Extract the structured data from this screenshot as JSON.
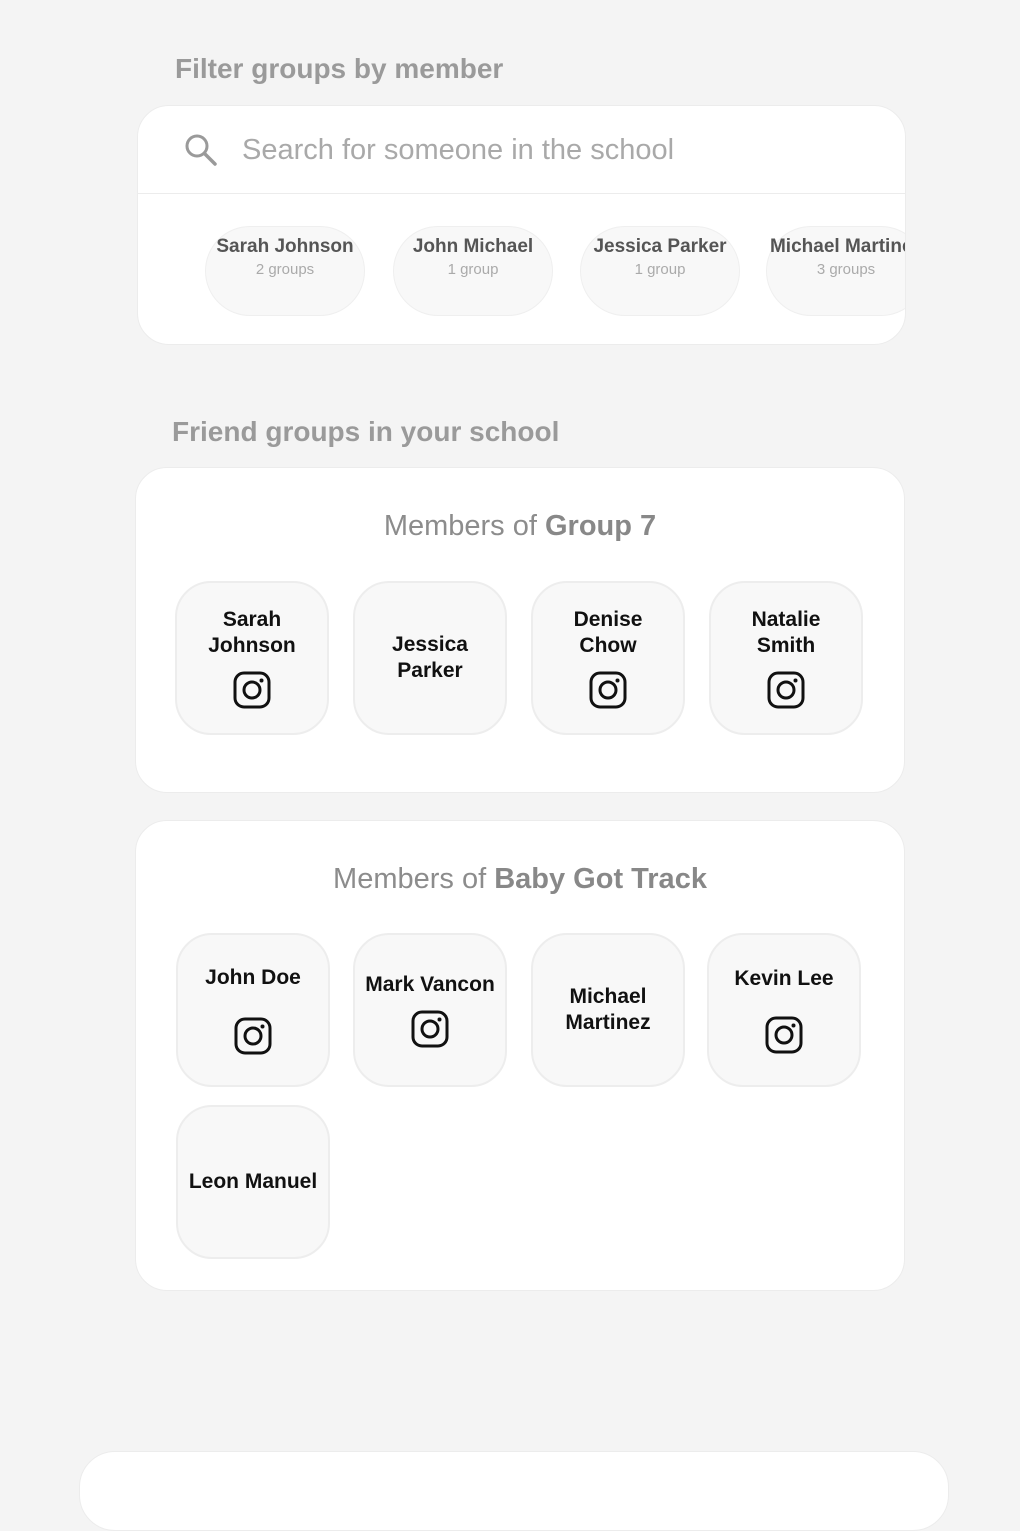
{
  "filter": {
    "title": "Filter groups by member",
    "search_placeholder": "Search for someone in the school",
    "chips": [
      {
        "name": "Sarah Johnson",
        "count": "2 groups"
      },
      {
        "name": "John Michael",
        "count": "1 group"
      },
      {
        "name": "Jessica Parker",
        "count": "1 group"
      },
      {
        "name": "Michael Martinez",
        "count": "3 groups"
      }
    ]
  },
  "groups_section": {
    "title": "Friend groups in your school",
    "members_of_label": "Members of",
    "groups": [
      {
        "name": "Group 7",
        "members": [
          {
            "name": "Sarah Johnson",
            "instagram": true
          },
          {
            "name": "Jessica Parker",
            "instagram": false
          },
          {
            "name": "Denise Chow",
            "instagram": true
          },
          {
            "name": "Natalie Smith",
            "instagram": true
          }
        ]
      },
      {
        "name": "Baby Got Track",
        "members": [
          {
            "name": "John Doe",
            "instagram": true
          },
          {
            "name": "Mark Vancon",
            "instagram": true
          },
          {
            "name": "Michael Martinez",
            "instagram": false
          },
          {
            "name": "Kevin Lee",
            "instagram": true
          },
          {
            "name": "Leon Manuel",
            "instagram": false
          }
        ]
      }
    ]
  },
  "colors": {
    "background": "#f4f4f4",
    "card": "#ffffff",
    "muted_text": "#9a9a9a"
  }
}
